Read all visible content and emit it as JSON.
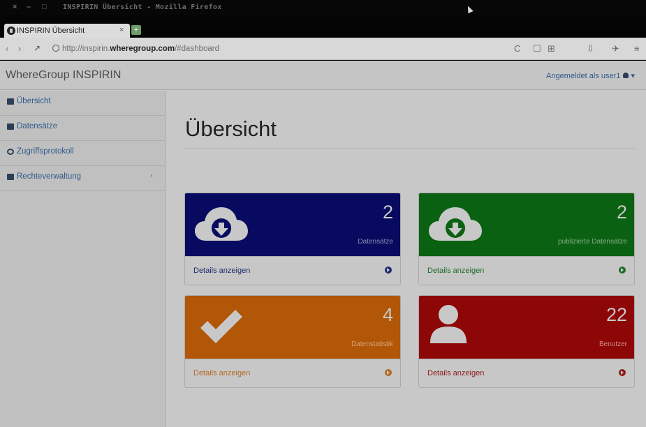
{
  "window": {
    "title": "INSPIRIN Übersicht - Mozilla Firefox",
    "controls": [
      "×",
      "–",
      "□"
    ]
  },
  "browser": {
    "tab_title": "INSPIRIN Übersicht",
    "tab_close": "×",
    "new_tab": "+",
    "url_prefix": "http://inspirin.",
    "url_domain": "wheregroup.com",
    "url_path": "/#dashboard",
    "back": "‹",
    "forward": "›",
    "reload": "C",
    "toolbar_icons": [
      "☐",
      "⊞",
      "⇩",
      "✈",
      "≡"
    ]
  },
  "app": {
    "brand": "WhereGroup INSPIRIN",
    "user_label": "Angemeldet als user1",
    "user_caret": "▾"
  },
  "sidebar": {
    "items": [
      {
        "label": "Übersicht",
        "icon": "home-icon"
      },
      {
        "label": "Datensätze",
        "icon": "database-icon"
      },
      {
        "label": "Zugriffsprotokoll",
        "icon": "history-icon"
      },
      {
        "label": "Rechteverwaltung",
        "icon": "users-icon",
        "arrow": "‹"
      }
    ]
  },
  "main": {
    "title": "Übersicht",
    "panels": [
      {
        "count": "2",
        "label": "Datensätze",
        "footer": "Details anzeigen",
        "color": "#070a5e",
        "icon": "cloud-download-icon"
      },
      {
        "count": "2",
        "label": "publizierte Datensätze",
        "footer": "Details anzeigen",
        "color": "#0b6112",
        "icon": "cloud-download-icon"
      },
      {
        "count": "4",
        "label": "Datenstatistik",
        "footer": "Details anzeigen",
        "color": "#b25607",
        "icon": "checkmark-icon"
      },
      {
        "count": "22",
        "label": "Benutzer",
        "footer": "Details anzeigen",
        "color": "#8d0707",
        "icon": "user-icon"
      }
    ]
  }
}
